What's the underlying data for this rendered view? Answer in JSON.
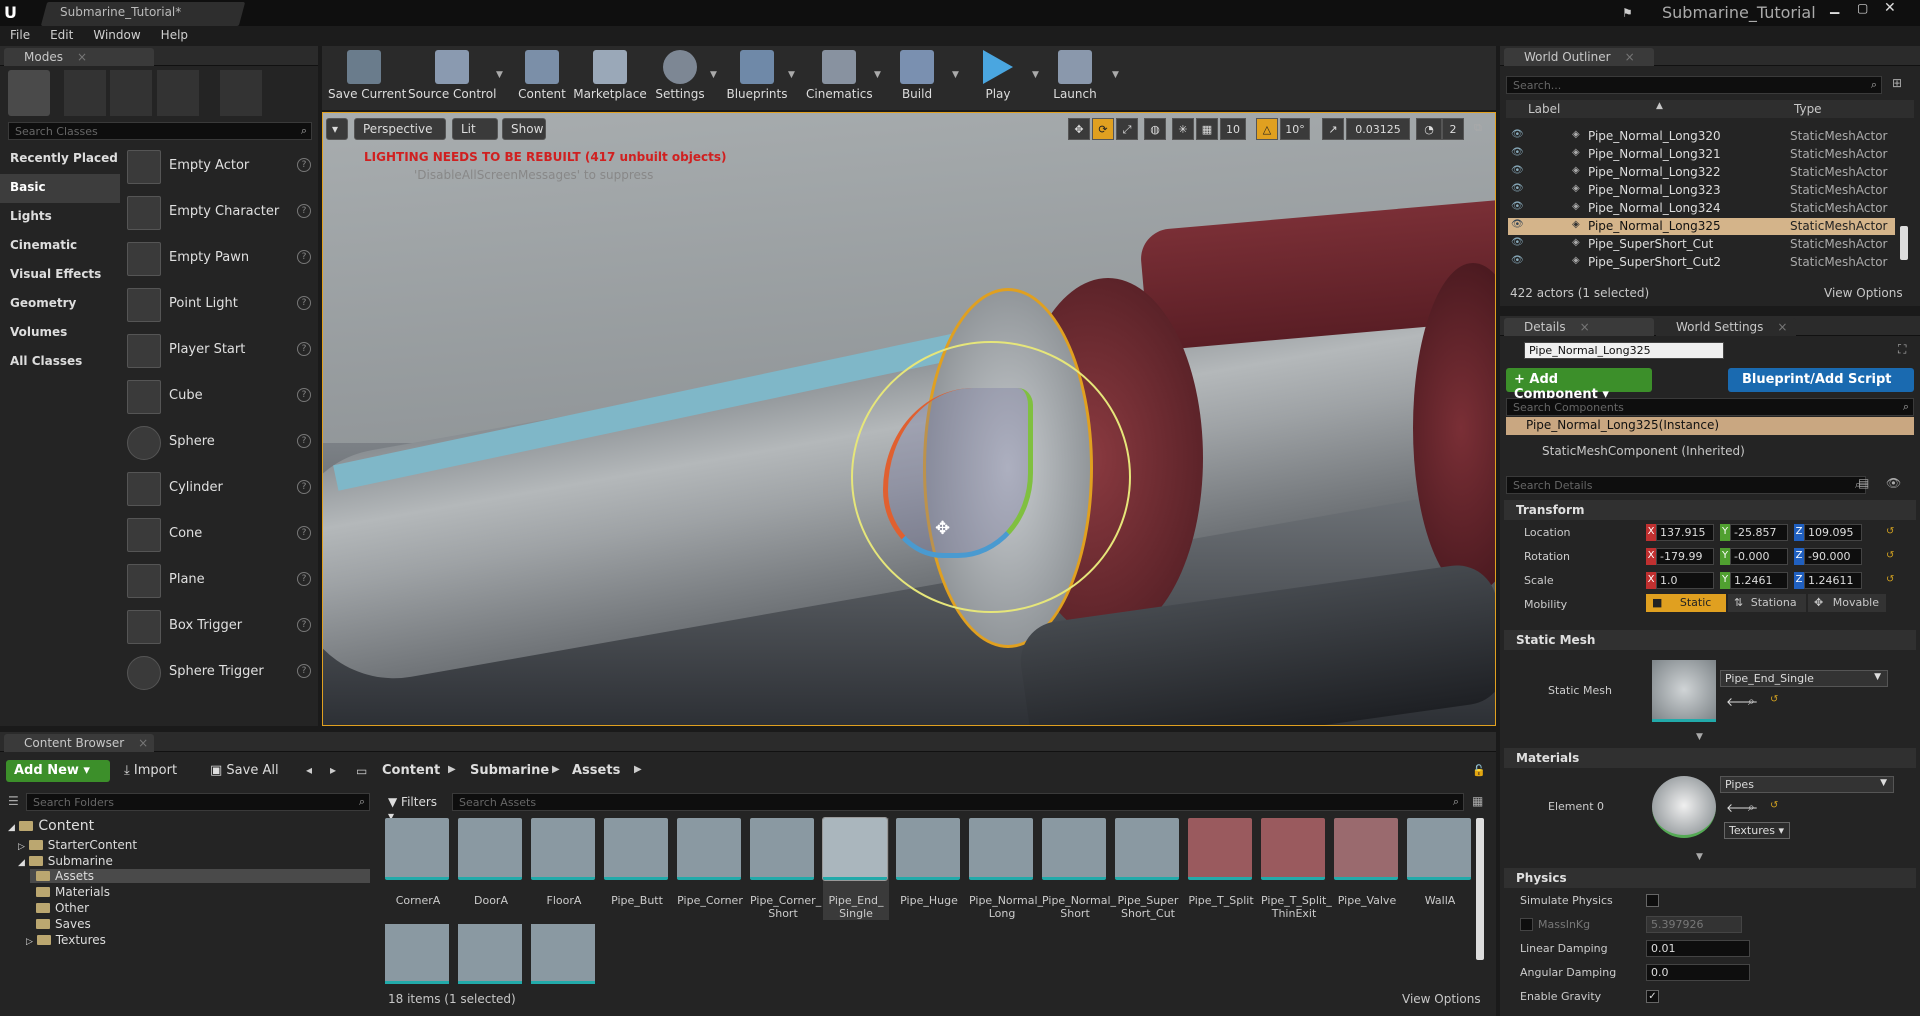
{
  "title_bar": {
    "tab": "Submarine_Tutorial*",
    "project": "Submarine_Tutorial"
  },
  "menu": [
    "File",
    "Edit",
    "Window",
    "Help"
  ],
  "modes": {
    "tab": "Modes",
    "search_placeholder": "Search Classes",
    "categories": [
      "Recently Placed",
      "Basic",
      "Lights",
      "Cinematic",
      "Visual Effects",
      "Geometry",
      "Volumes",
      "All Classes"
    ],
    "selected_category": "Basic",
    "items": [
      "Empty Actor",
      "Empty Character",
      "Empty Pawn",
      "Point Light",
      "Player Start",
      "Cube",
      "Sphere",
      "Cylinder",
      "Cone",
      "Plane",
      "Box Trigger",
      "Sphere Trigger"
    ]
  },
  "toolbar": [
    "Save Current",
    "Source Control",
    "Content",
    "Marketplace",
    "Settings",
    "Blueprints",
    "Cinematics",
    "Build",
    "Play",
    "Launch"
  ],
  "viewport": {
    "perspective": "Perspective",
    "lit": "Lit",
    "show": "Show",
    "warning": "LIGHTING NEEDS TO BE REBUILT (417 unbuilt objects)",
    "suppress": "'DisableAllScreenMessages' to suppress",
    "grid_snap": "10",
    "rot_snap": "10°",
    "scale_snap": "0.03125",
    "cam_speed": "2"
  },
  "outliner": {
    "tab": "World Outliner",
    "search_placeholder": "Search...",
    "col_label": "Label",
    "col_type": "Type",
    "rows": [
      {
        "label": "Pipe_Normal_Long320",
        "type": "StaticMeshActor"
      },
      {
        "label": "Pipe_Normal_Long321",
        "type": "StaticMeshActor"
      },
      {
        "label": "Pipe_Normal_Long322",
        "type": "StaticMeshActor"
      },
      {
        "label": "Pipe_Normal_Long323",
        "type": "StaticMeshActor"
      },
      {
        "label": "Pipe_Normal_Long324",
        "type": "StaticMeshActor"
      },
      {
        "label": "Pipe_Normal_Long325",
        "type": "StaticMeshActor"
      },
      {
        "label": "Pipe_SuperShort_Cut",
        "type": "StaticMeshActor"
      },
      {
        "label": "Pipe_SuperShort_Cut2",
        "type": "StaticMeshActor"
      }
    ],
    "selected_label": "Pipe_Normal_Long325",
    "status": "422 actors (1 selected)",
    "view_options": "View Options"
  },
  "details": {
    "tab": "Details",
    "tab2": "World Settings",
    "name": "Pipe_Normal_Long325",
    "add_component": "+ Add Component",
    "blueprint": "Blueprint/Add Script",
    "search_components": "Search Components",
    "instance": "Pipe_Normal_Long325(Instance)",
    "component": "StaticMeshComponent (Inherited)",
    "search_details": "Search Details",
    "transform": {
      "header": "Transform",
      "location_label": "Location",
      "rotation_label": "Rotation",
      "scale_label": "Scale",
      "mobility_label": "Mobility",
      "location": [
        "137.915",
        "-25.857",
        "109.095"
      ],
      "rotation": [
        "-179.99",
        "-0.000",
        "-90.000"
      ],
      "scale": [
        "1.0",
        "1.2461",
        "1.24611"
      ],
      "mobility": [
        "Static",
        "Stationa",
        "Movable"
      ]
    },
    "static_mesh": {
      "header": "Static Mesh",
      "label": "Static Mesh",
      "value": "Pipe_End_Single"
    },
    "materials": {
      "header": "Materials",
      "element": "Element 0",
      "value": "Pipes",
      "textures": "Textures"
    },
    "physics": {
      "header": "Physics",
      "simulate": "Simulate Physics",
      "mass": "MassInKg",
      "mass_value": "5.397926",
      "linear": "Linear Damping",
      "linear_value": "0.01",
      "angular": "Angular Damping",
      "angular_value": "0.0",
      "gravity": "Enable Gravity"
    }
  },
  "content_browser": {
    "tab": "Content Browser",
    "add_new": "Add New",
    "import": "Import",
    "save_all": "Save All",
    "path": [
      "Content",
      "Submarine",
      "Assets"
    ],
    "search_folders": "Search Folders",
    "filters": "Filters",
    "search_assets": "Search Assets",
    "folders": [
      "Content",
      "StarterContent",
      "Submarine",
      "Assets",
      "Materials",
      "Other",
      "Saves",
      "Textures"
    ],
    "assets": [
      "CornerA",
      "DoorA",
      "FloorA",
      "Pipe_Butt",
      "Pipe_Corner",
      "Pipe_Corner_\nShort",
      "Pipe_End_\nSingle",
      "Pipe_Huge",
      "Pipe_Normal_\nLong",
      "Pipe_Normal_\nShort",
      "Pipe_Super\nShort_Cut",
      "Pipe_T_Split",
      "Pipe_T_Split_\nThinExit",
      "Pipe_Valve",
      "WallA"
    ],
    "selected_asset": "Pipe_End_\nSingle",
    "status": "18 items (1 selected)",
    "view_options": "View Options"
  }
}
